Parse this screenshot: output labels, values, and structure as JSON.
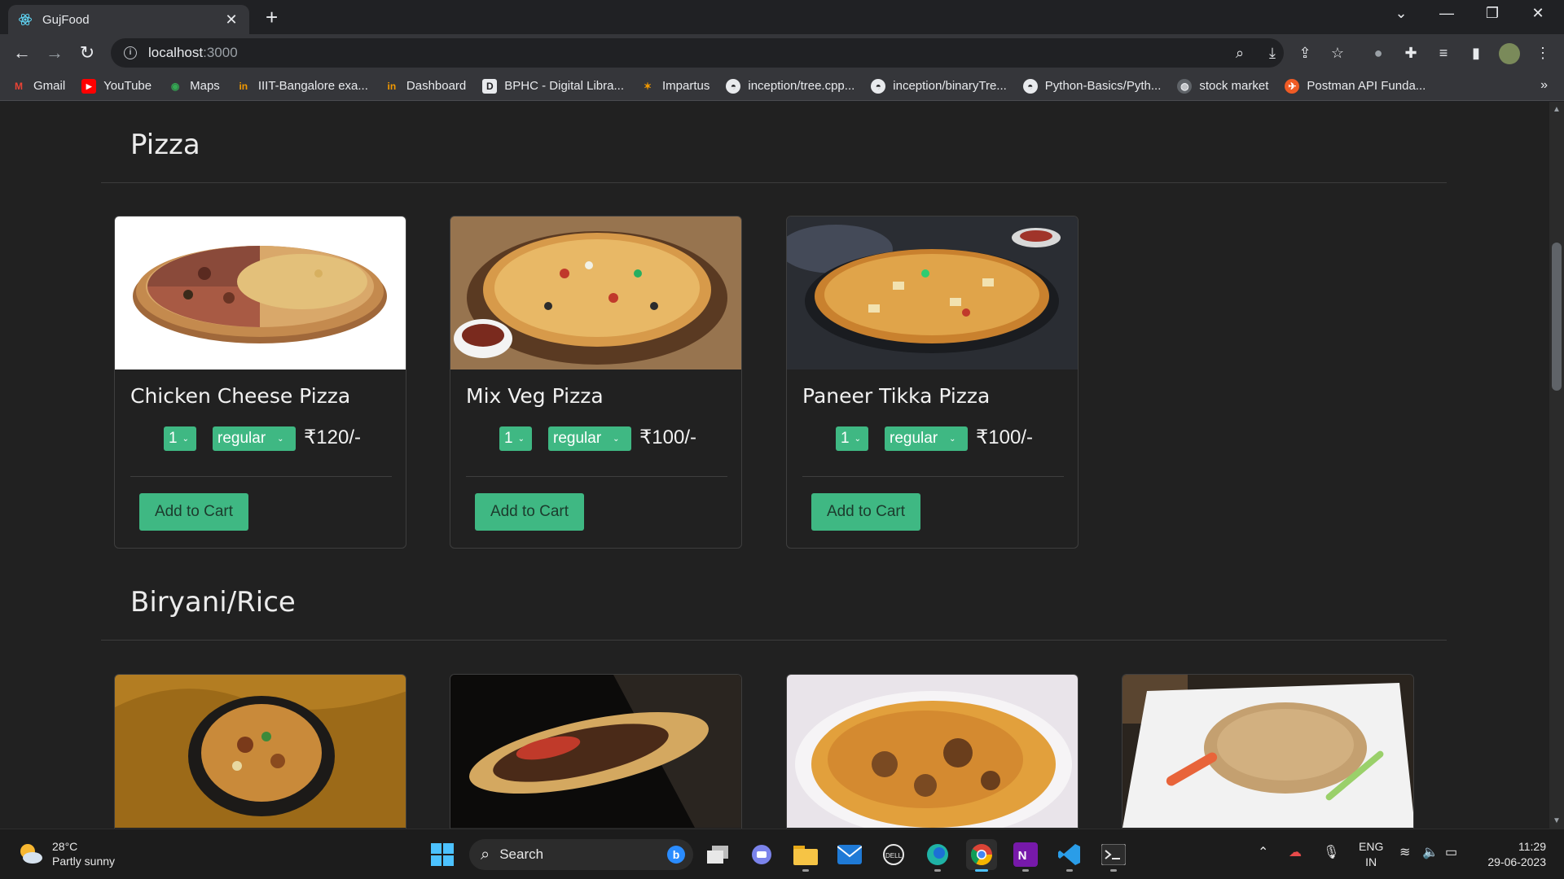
{
  "browser": {
    "tab_title": "GujFood",
    "url_host": "localhost",
    "url_port": ":3000",
    "bookmarks": [
      {
        "label": "Gmail",
        "icon": "gmail-icon"
      },
      {
        "label": "YouTube",
        "icon": "youtube-icon"
      },
      {
        "label": "Maps",
        "icon": "maps-icon"
      },
      {
        "label": "IIIT-Bangalore exa...",
        "icon": "iiitb-icon"
      },
      {
        "label": "Dashboard",
        "icon": "iiitb-icon"
      },
      {
        "label": "BPHC - Digital Libra...",
        "icon": "document-icon"
      },
      {
        "label": "Impartus",
        "icon": "impartus-icon"
      },
      {
        "label": "inception/tree.cpp...",
        "icon": "github-icon"
      },
      {
        "label": "inception/binaryTre...",
        "icon": "github-icon"
      },
      {
        "label": "Python-Basics/Pyth...",
        "icon": "github-icon"
      },
      {
        "label": "stock market",
        "icon": "globe-icon"
      },
      {
        "label": "Postman API Funda...",
        "icon": "postman-icon"
      }
    ]
  },
  "sections": [
    {
      "title": "Pizza",
      "items": [
        {
          "name": "Chicken Cheese Pizza",
          "qty": "1",
          "size": "regular",
          "price": "₹120/-",
          "button": "Add to Cart"
        },
        {
          "name": "Mix Veg Pizza",
          "qty": "1",
          "size": "regular",
          "price": "₹100/-",
          "button": "Add to Cart"
        },
        {
          "name": "Paneer Tikka Pizza",
          "qty": "1",
          "size": "regular",
          "price": "₹100/-",
          "button": "Add to Cart"
        }
      ]
    },
    {
      "title": "Biryani/Rice"
    }
  ],
  "taskbar": {
    "temperature": "28°C",
    "weather": "Partly sunny",
    "search_label": "Search",
    "lang_top": "ENG",
    "lang_bottom": "IN",
    "time": "11:29",
    "date": "29-06-2023"
  },
  "colors": {
    "accent": "#3fb883",
    "background": "#212121"
  }
}
